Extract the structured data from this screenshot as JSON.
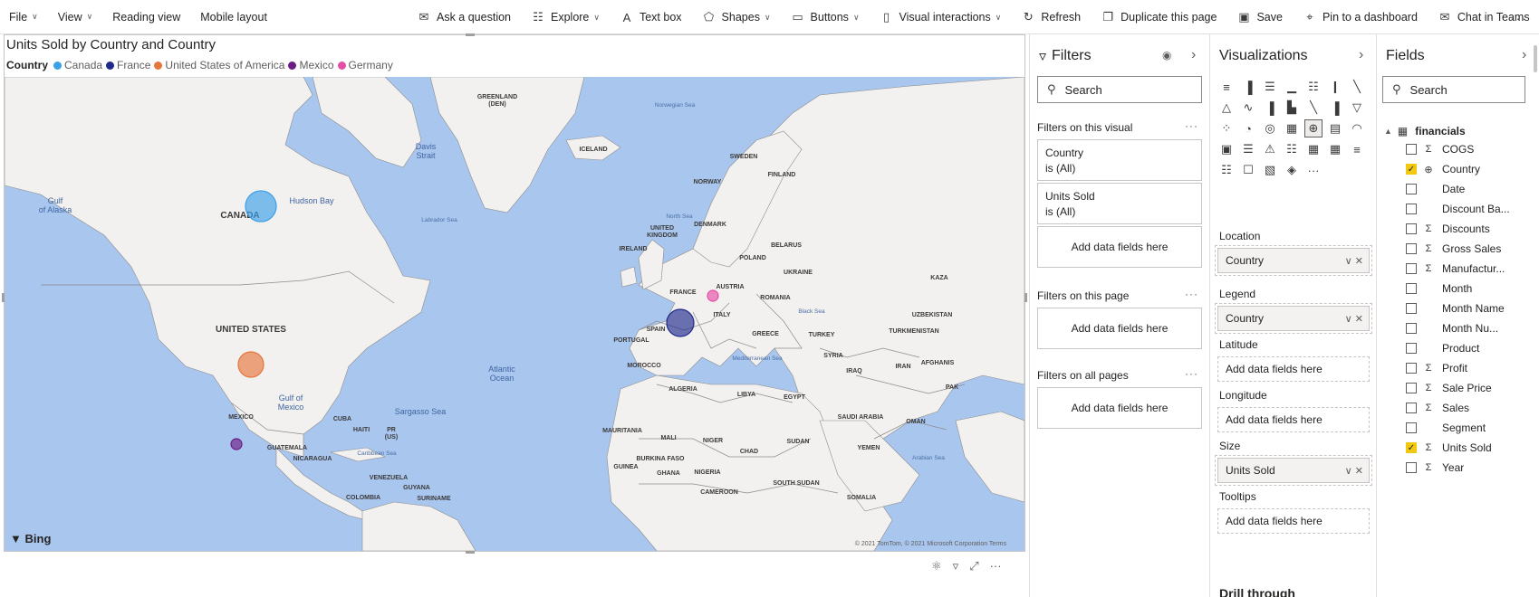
{
  "toolbar": {
    "left": [
      {
        "label": "File",
        "chevron": true
      },
      {
        "label": "View",
        "chevron": true
      },
      {
        "label": "Reading view",
        "chevron": false
      },
      {
        "label": "Mobile layout",
        "chevron": false
      }
    ],
    "right": [
      {
        "label": "Ask a question",
        "icon": "✉",
        "icon_name": "ask-question-icon",
        "chevron": false
      },
      {
        "label": "Explore",
        "icon": "☷",
        "icon_name": "explore-icon",
        "chevron": true
      },
      {
        "label": "Text box",
        "icon": "A",
        "icon_name": "text-box-icon",
        "chevron": false
      },
      {
        "label": "Shapes",
        "icon": "⬠",
        "icon_name": "shapes-icon",
        "chevron": true
      },
      {
        "label": "Buttons",
        "icon": "▭",
        "icon_name": "buttons-icon",
        "chevron": true
      },
      {
        "label": "Visual interactions",
        "icon": "▯",
        "icon_name": "visual-interactions-icon",
        "chevron": true
      },
      {
        "label": "Refresh",
        "icon": "↻",
        "icon_name": "refresh-icon",
        "chevron": false
      },
      {
        "label": "Duplicate this page",
        "icon": "❐",
        "icon_name": "duplicate-icon",
        "chevron": false
      },
      {
        "label": "Save",
        "icon": "▣",
        "icon_name": "save-icon",
        "chevron": false
      },
      {
        "label": "Pin to a dashboard",
        "icon": "⌖",
        "icon_name": "pin-icon",
        "chevron": false
      },
      {
        "label": "Chat in Teams",
        "icon": "✉",
        "icon_name": "teams-icon",
        "chevron": false
      }
    ],
    "more": "···"
  },
  "visual": {
    "title": "Units Sold by Country and Country",
    "legend_title": "Country",
    "legend": [
      {
        "label": "Canada",
        "color": "#3ba0e8"
      },
      {
        "label": "France",
        "color": "#1f2a8c"
      },
      {
        "label": "United States of America",
        "color": "#e6763c"
      },
      {
        "label": "Mexico",
        "color": "#6b1d85"
      },
      {
        "label": "Germany",
        "color": "#e64ea6"
      }
    ],
    "bing": "Bing",
    "copyright": "© 2021 TomTom, © 2021 Microsoft Corporation  Terms"
  },
  "map": {
    "ocean_color": "#a9c6ee",
    "land_color": "#f2f1ef",
    "border_color": "#8c8c8c",
    "labels": [
      {
        "text": "GREENLAND",
        "sub": "(DEN)",
        "cls": "country"
      },
      {
        "text": "Norwegian Sea",
        "cls": "sea"
      },
      {
        "text": "ICELAND",
        "cls": "country"
      },
      {
        "text": "SWEDEN",
        "cls": "country"
      },
      {
        "text": "FINLAND",
        "cls": "country"
      },
      {
        "text": "NORWAY",
        "cls": "country"
      },
      {
        "text": "Davis",
        "sub": "Strait",
        "cls": "water"
      },
      {
        "text": "Hudson Bay",
        "cls": "water"
      },
      {
        "text": "Labrador Sea",
        "cls": "sea"
      },
      {
        "text": "Gulf",
        "sub": "of Alaska",
        "cls": "water"
      },
      {
        "text": "CANADA",
        "cls": "big"
      },
      {
        "text": "North Sea",
        "cls": "sea"
      },
      {
        "text": "UNITED",
        "sub": "KINGDOM",
        "cls": "country"
      },
      {
        "text": "DENMARK",
        "cls": "country"
      },
      {
        "text": "IRELAND",
        "cls": "country"
      },
      {
        "text": "BELARUS",
        "cls": "country"
      },
      {
        "text": "POLAND",
        "cls": "country"
      },
      {
        "text": "UKRAINE",
        "cls": "country"
      },
      {
        "text": "KAZA",
        "cls": "country"
      },
      {
        "text": "FRANCE",
        "cls": "country"
      },
      {
        "text": "AUSTRIA",
        "cls": "country"
      },
      {
        "text": "ROMANIA",
        "cls": "country"
      },
      {
        "text": "Black Sea",
        "cls": "sea"
      },
      {
        "text": "UZBEKISTAN",
        "cls": "country"
      },
      {
        "text": "ITALY",
        "cls": "country"
      },
      {
        "text": "UNITED STATES",
        "cls": "big"
      },
      {
        "text": "SPAIN",
        "cls": "country"
      },
      {
        "text": "PORTUGAL",
        "cls": "country"
      },
      {
        "text": "GREECE",
        "cls": "country"
      },
      {
        "text": "TURKEY",
        "cls": "country"
      },
      {
        "text": "TURKMENISTAN",
        "cls": "country"
      },
      {
        "text": "SYRIA",
        "cls": "country"
      },
      {
        "text": "Mediterranean Sea",
        "cls": "sea"
      },
      {
        "text": "IRAQ",
        "cls": "country"
      },
      {
        "text": "IRAN",
        "cls": "country"
      },
      {
        "text": "AFGHANIS",
        "cls": "country"
      },
      {
        "text": "MOROCCO",
        "cls": "country"
      },
      {
        "text": "Atlantic",
        "sub": "Ocean",
        "cls": "water"
      },
      {
        "text": "ALGERIA",
        "cls": "country"
      },
      {
        "text": "LIBYA",
        "cls": "country"
      },
      {
        "text": "EGYPT",
        "cls": "country"
      },
      {
        "text": "PAK",
        "cls": "country"
      },
      {
        "text": "Gulf of",
        "sub": "Mexico",
        "cls": "water"
      },
      {
        "text": "Sargasso Sea",
        "cls": "water"
      },
      {
        "text": "MEXICO",
        "cls": "country"
      },
      {
        "text": "CUBA",
        "cls": "country"
      },
      {
        "text": "HAITI",
        "cls": "country"
      },
      {
        "text": "PR",
        "sub": "(US)",
        "cls": "country"
      },
      {
        "text": "SAUDI ARABIA",
        "cls": "country"
      },
      {
        "text": "OMAN",
        "cls": "country"
      },
      {
        "text": "MAURITANIA",
        "cls": "country"
      },
      {
        "text": "MALI",
        "cls": "country"
      },
      {
        "text": "NIGER",
        "cls": "country"
      },
      {
        "text": "CHAD",
        "cls": "country"
      },
      {
        "text": "SUDAN",
        "cls": "country"
      },
      {
        "text": "YEMEN",
        "cls": "country"
      },
      {
        "text": "GUATEMALA",
        "cls": "country"
      },
      {
        "text": "NICARAGUA",
        "cls": "country"
      },
      {
        "text": "Caribbean Sea",
        "cls": "sea"
      },
      {
        "text": "Arabian Sea",
        "cls": "sea"
      },
      {
        "text": "BURKINA FASO",
        "cls": "country"
      },
      {
        "text": "GUINEA",
        "cls": "country"
      },
      {
        "text": "GHANA",
        "cls": "country"
      },
      {
        "text": "NIGERIA",
        "cls": "country"
      },
      {
        "text": "VENEZUELA",
        "cls": "country"
      },
      {
        "text": "GUYANA",
        "cls": "country"
      },
      {
        "text": "SURINAME",
        "cls": "country"
      },
      {
        "text": "COLOMBIA",
        "cls": "country"
      },
      {
        "text": "CAMEROON",
        "cls": "country"
      },
      {
        "text": "SOUTH SUDAN",
        "cls": "country"
      },
      {
        "text": "SOMALIA",
        "cls": "country"
      }
    ],
    "bubbles": [
      {
        "country": "Canada",
        "color": "#3ba0e8"
      },
      {
        "country": "France",
        "color": "#1f2a8c"
      },
      {
        "country": "United States of America",
        "color": "#e6763c"
      },
      {
        "country": "Mexico",
        "color": "#6b1d85"
      },
      {
        "country": "Germany",
        "color": "#e64ea6"
      }
    ]
  },
  "filters": {
    "title": "Filters",
    "search": "Search",
    "on_visual_label": "Filters on this visual",
    "cards": [
      {
        "name": "Country",
        "state": "is (All)"
      },
      {
        "name": "Units Sold",
        "state": "is (All)"
      }
    ],
    "add_fields": "Add data fields here",
    "on_page_label": "Filters on this page",
    "on_all_label": "Filters on all pages",
    "more": "···"
  },
  "visualizations": {
    "title": "Visualizations",
    "icons": [
      "≡",
      "▐",
      "☰",
      "▁",
      "☷",
      "❙",
      "╲",
      "△",
      "∿",
      "▐",
      "▙",
      "╲",
      "▐",
      "▽",
      "⁘",
      "◔",
      "◎",
      "▦",
      "⊕",
      "▤",
      "◠",
      "▣",
      "☰",
      "⚠",
      "☷",
      "▦",
      "▦",
      "≡",
      "☷",
      "☐",
      "▧",
      "◈",
      "···"
    ],
    "selected_index": 18,
    "wells": [
      {
        "label": "Location",
        "value": "Country",
        "filled": true
      },
      {
        "label": "Legend",
        "value": "Country",
        "filled": true
      },
      {
        "label": "Latitude",
        "value": "Add data fields here",
        "filled": false
      },
      {
        "label": "Longitude",
        "value": "Add data fields here",
        "filled": false
      },
      {
        "label": "Size",
        "value": "Units Sold",
        "filled": true
      },
      {
        "label": "Tooltips",
        "value": "Add data fields here",
        "filled": false
      }
    ],
    "drill": "Drill through"
  },
  "fields": {
    "title": "Fields",
    "search": "Search",
    "table": "financials",
    "items": [
      {
        "name": "COGS",
        "type": "Σ",
        "checked": false
      },
      {
        "name": "Country",
        "type": "⊕",
        "checked": true
      },
      {
        "name": "Date",
        "type": "",
        "checked": false
      },
      {
        "name": "Discount Ba...",
        "type": "",
        "checked": false
      },
      {
        "name": "Discounts",
        "type": "Σ",
        "checked": false
      },
      {
        "name": "Gross Sales",
        "type": "Σ",
        "checked": false
      },
      {
        "name": "Manufactur...",
        "type": "Σ",
        "checked": false
      },
      {
        "name": "Month",
        "type": "",
        "checked": false
      },
      {
        "name": "Month Name",
        "type": "",
        "checked": false
      },
      {
        "name": "Month Nu...",
        "type": "",
        "checked": false
      },
      {
        "name": "Product",
        "type": "",
        "checked": false
      },
      {
        "name": "Profit",
        "type": "Σ",
        "checked": false
      },
      {
        "name": "Sale Price",
        "type": "Σ",
        "checked": false
      },
      {
        "name": "Sales",
        "type": "Σ",
        "checked": false
      },
      {
        "name": "Segment",
        "type": "",
        "checked": false
      },
      {
        "name": "Units Sold",
        "type": "Σ",
        "checked": true
      },
      {
        "name": "Year",
        "type": "Σ",
        "checked": false
      }
    ]
  }
}
